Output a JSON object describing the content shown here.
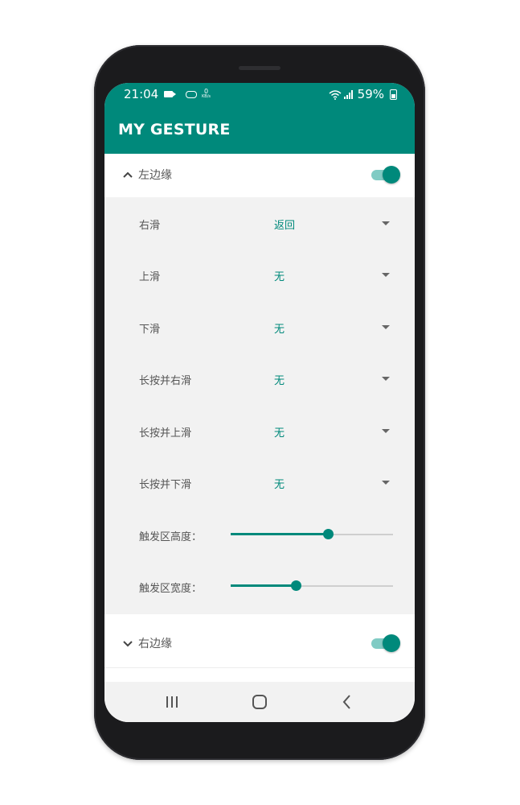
{
  "status": {
    "time": "21:04",
    "kbs_value": "0",
    "kbs_unit": "KB/s",
    "battery": "59%"
  },
  "app": {
    "title": "MY GESTURE",
    "accent_color": "#00897b"
  },
  "sections": {
    "left_edge": {
      "label": "左边缘",
      "enabled": true,
      "expanded": true
    },
    "right_edge": {
      "label": "右边缘",
      "enabled": true,
      "expanded": false
    }
  },
  "gestures": [
    {
      "label": "右滑",
      "value": "返回"
    },
    {
      "label": "上滑",
      "value": "无"
    },
    {
      "label": "下滑",
      "value": "无"
    },
    {
      "label": "长按并右滑",
      "value": "无"
    },
    {
      "label": "长按并上滑",
      "value": "无"
    },
    {
      "label": "长按并下滑",
      "value": "无"
    }
  ],
  "sliders": {
    "height": {
      "label": "触发区高度：",
      "value": 0.6
    },
    "width": {
      "label": "触发区宽度：",
      "value": 0.4
    }
  },
  "icons": {
    "expand_up": "chevron-up-icon",
    "expand_down": "chevron-down-icon",
    "dropdown": "caret-down-icon",
    "nav_recents": "recents-icon",
    "nav_home": "home-icon",
    "nav_back": "back-icon"
  }
}
